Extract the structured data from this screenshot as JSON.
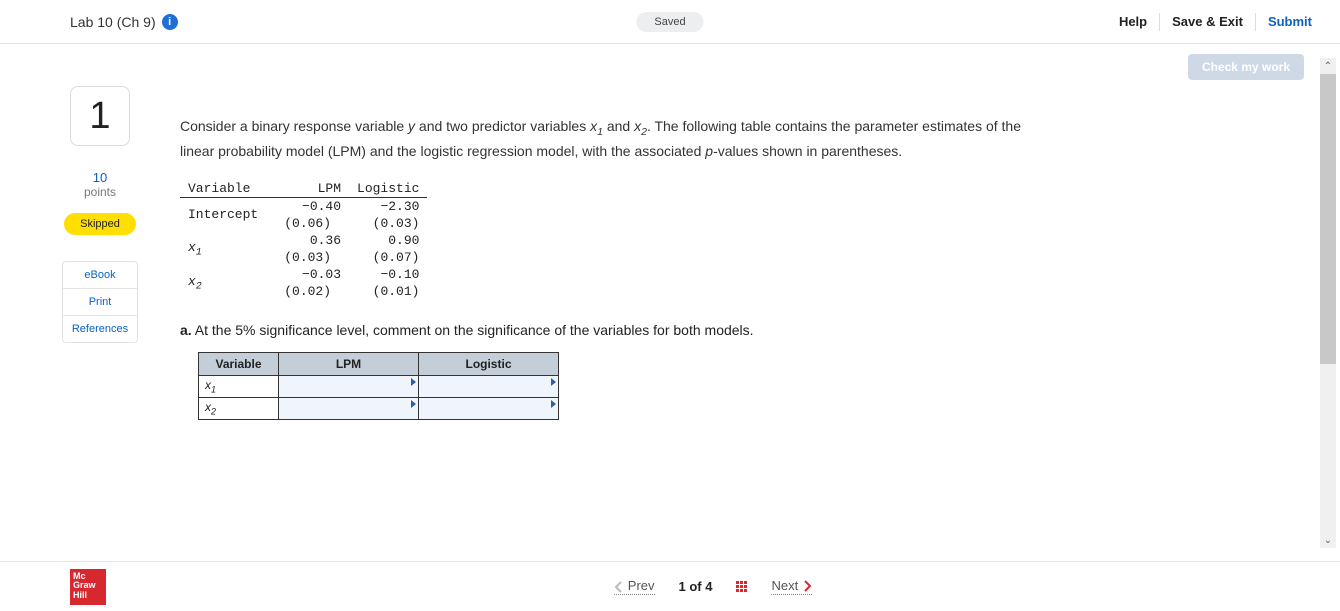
{
  "header": {
    "title": "Lab 10 (Ch 9)",
    "saved_label": "Saved",
    "help": "Help",
    "save_exit": "Save & Exit",
    "submit": "Submit"
  },
  "check_my_work": "Check my work",
  "sidebar": {
    "question_number": "1",
    "points_value": "10",
    "points_label": "points",
    "skipped": "Skipped",
    "links": {
      "ebook": "eBook",
      "print": "Print",
      "references": "References"
    }
  },
  "question": {
    "prompt_pre": "Consider a binary response variable ",
    "prompt_y": "y",
    "prompt_mid1": " and two predictor variables ",
    "prompt_x1": "x",
    "prompt_x1_sub": "1",
    "prompt_mid2": " and ",
    "prompt_x2": "x",
    "prompt_x2_sub": "2",
    "prompt_mid3": ". The following table contains the parameter estimates of the linear probability model (LPM) and the logistic regression model, with the associated ",
    "prompt_p": "p",
    "prompt_end": "-values shown in parentheses.",
    "table_headers": {
      "var": "Variable",
      "lpm": "LPM",
      "log": "Logistic"
    },
    "rows": [
      {
        "var": "Intercept",
        "lpm_est": "−0.40",
        "lpm_p": "(0.06)",
        "log_est": "−2.30",
        "log_p": "(0.03)"
      },
      {
        "var": "x1",
        "lpm_est": "0.36",
        "lpm_p": "(0.03)",
        "log_est": "0.90",
        "log_p": "(0.07)"
      },
      {
        "var": "x2",
        "lpm_est": "−0.03",
        "lpm_p": "(0.02)",
        "log_est": "−0.10",
        "log_p": "(0.01)"
      }
    ],
    "part_a_label": "a.",
    "part_a_text": " At the 5% significance level, comment on the significance of the variables for both models.",
    "answer_headers": {
      "var": "Variable",
      "lpm": "LPM",
      "log": "Logistic"
    },
    "answer_rows": [
      {
        "var": "x",
        "sub": "1"
      },
      {
        "var": "x",
        "sub": "2"
      }
    ]
  },
  "footer": {
    "logo_lines": [
      "Mc",
      "Graw",
      "Hill"
    ],
    "prev": "Prev",
    "page_of": "1 of 4",
    "next": "Next"
  }
}
